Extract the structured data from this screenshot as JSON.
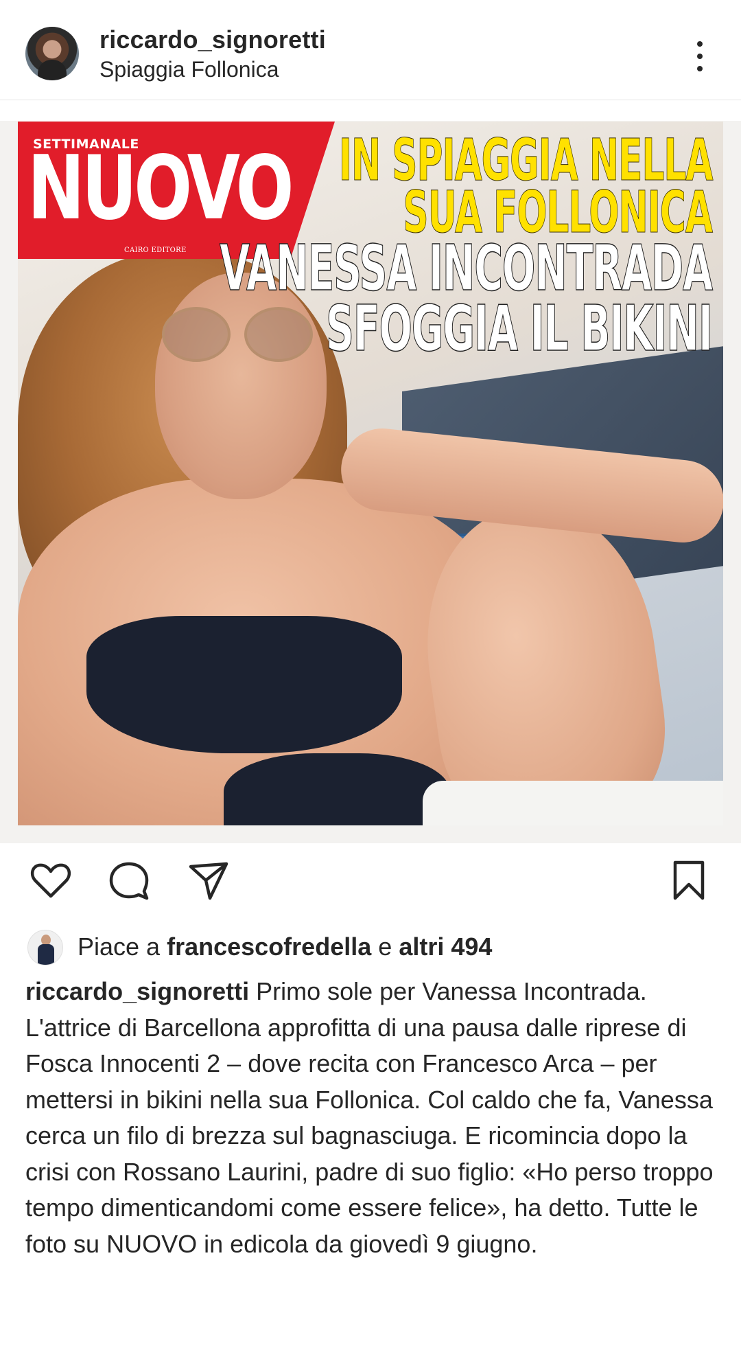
{
  "header": {
    "username": "riccardo_signoretti",
    "location": "Spiaggia Follonica"
  },
  "magazine": {
    "kicker": "SETTIMANALE",
    "title": "NUOVO",
    "publisher": "CAIRO EDITORE",
    "headline_yellow": [
      "IN SPIAGGIA NELLA",
      "SUA FOLLONICA"
    ],
    "headline_white": [
      "VANESSA INCONTRADA",
      "SFOGGIA IL BIKINI"
    ]
  },
  "actions": {
    "icons": [
      "heart-icon",
      "comment-icon",
      "share-icon",
      "bookmark-icon"
    ]
  },
  "likes": {
    "prefix": "Piace a",
    "user": "francescofredella",
    "connector": "e",
    "others": "altri 494"
  },
  "caption": {
    "username": "riccardo_signoretti",
    "text": "Primo sole per Vanessa Incontrada. L'attrice di Barcellona approfitta di una pausa dalle riprese di Fosca Innocenti 2 – dove recita con Francesco Arca – per mettersi in bikini nella sua Follonica. Col caldo che fa, Vanessa cerca un filo di brezza sul bagnasciuga. E ricomincia dopo la crisi con Rossano Laurini, padre di suo figlio: «Ho perso troppo tempo dimenticandomi come essere felice», ha detto. Tutte le foto su NUOVO in edicola da giovedì 9 giugno."
  },
  "colors": {
    "magazine_red": "#e11d2a",
    "headline_yellow": "#ffe100",
    "text": "#262626"
  }
}
